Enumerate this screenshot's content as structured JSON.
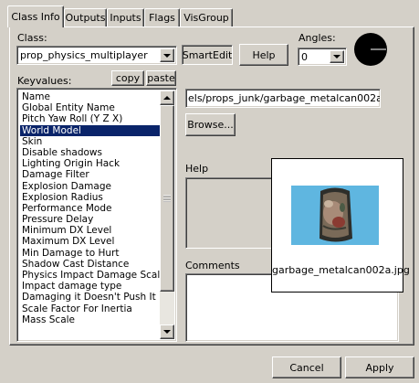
{
  "tabs": [
    {
      "label": "Class Info"
    },
    {
      "label": "Outputs"
    },
    {
      "label": "Inputs"
    },
    {
      "label": "Flags"
    },
    {
      "label": "VisGroup"
    }
  ],
  "class_label": "Class:",
  "class_value": "prop_physics_multiplayer",
  "smartedit_label": "SmartEdit",
  "help_button_label": "Help",
  "angles_label": "Angles:",
  "angles_value": "0",
  "keyvalues_label": "Keyvalues:",
  "copy_label": "copy",
  "paste_label": "paste",
  "keyvalues": [
    {
      "label": "Name"
    },
    {
      "label": "Global Entity Name"
    },
    {
      "label": "Pitch Yaw Roll (Y Z X)"
    },
    {
      "label": "World Model",
      "selected": true
    },
    {
      "label": "Skin"
    },
    {
      "label": "Disable shadows"
    },
    {
      "label": "Lighting Origin Hack"
    },
    {
      "label": "Damage Filter"
    },
    {
      "label": "Explosion Damage"
    },
    {
      "label": "Explosion Radius"
    },
    {
      "label": "Performance Mode"
    },
    {
      "label": "Pressure Delay"
    },
    {
      "label": "Minimum DX Level"
    },
    {
      "label": "Maximum DX Level"
    },
    {
      "label": "Min Damage to Hurt"
    },
    {
      "label": "Shadow Cast Distance"
    },
    {
      "label": "Physics Impact Damage Scale"
    },
    {
      "label": "Impact damage type"
    },
    {
      "label": "Damaging it Doesn't Push It"
    },
    {
      "label": "Scale Factor For Inertia"
    },
    {
      "label": "Mass Scale"
    }
  ],
  "value_field": "els/props_junk/garbage_metalcan002a.mdl",
  "browse_label": "Browse...",
  "help_section_label": "Help",
  "comments_label": "Comments",
  "preview": {
    "caption": "garbage_metalcan002a.jpg",
    "bg_color": "#5fb6e0"
  },
  "cancel_label": "Cancel",
  "apply_label": "Apply"
}
